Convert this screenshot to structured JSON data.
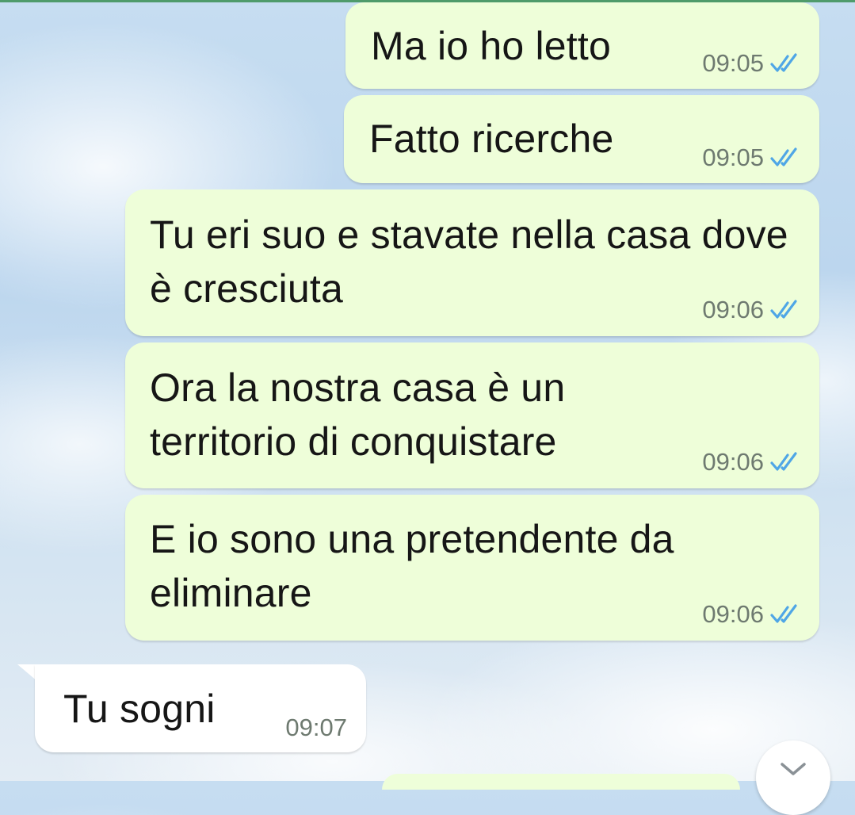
{
  "conversation": {
    "messages": [
      {
        "direction": "outgoing",
        "text": "Ma io ho letto",
        "time": "09:05",
        "status": "read"
      },
      {
        "direction": "outgoing",
        "text": "Fatto ricerche",
        "time": "09:05",
        "status": "read"
      },
      {
        "direction": "outgoing",
        "text": "Tu eri suo e stavate nella casa dove è cresciuta",
        "time": "09:06",
        "status": "read"
      },
      {
        "direction": "outgoing",
        "text": "Ora la nostra casa è un territorio di conquistare",
        "time": "09:06",
        "status": "read"
      },
      {
        "direction": "outgoing",
        "text": "E io sono una pretendente da eliminare",
        "time": "09:06",
        "status": "read"
      },
      {
        "direction": "incoming",
        "text": "Tu sogni",
        "time": "09:07"
      }
    ]
  },
  "colors": {
    "outgoing_bubble": "#eefed9",
    "incoming_bubble": "#ffffff",
    "read_ticks": "#4fa6e6",
    "timestamp": "#6e7a70"
  },
  "icons": {
    "read_status": "double-check-icon",
    "scroll_down": "chevron-down-icon"
  }
}
